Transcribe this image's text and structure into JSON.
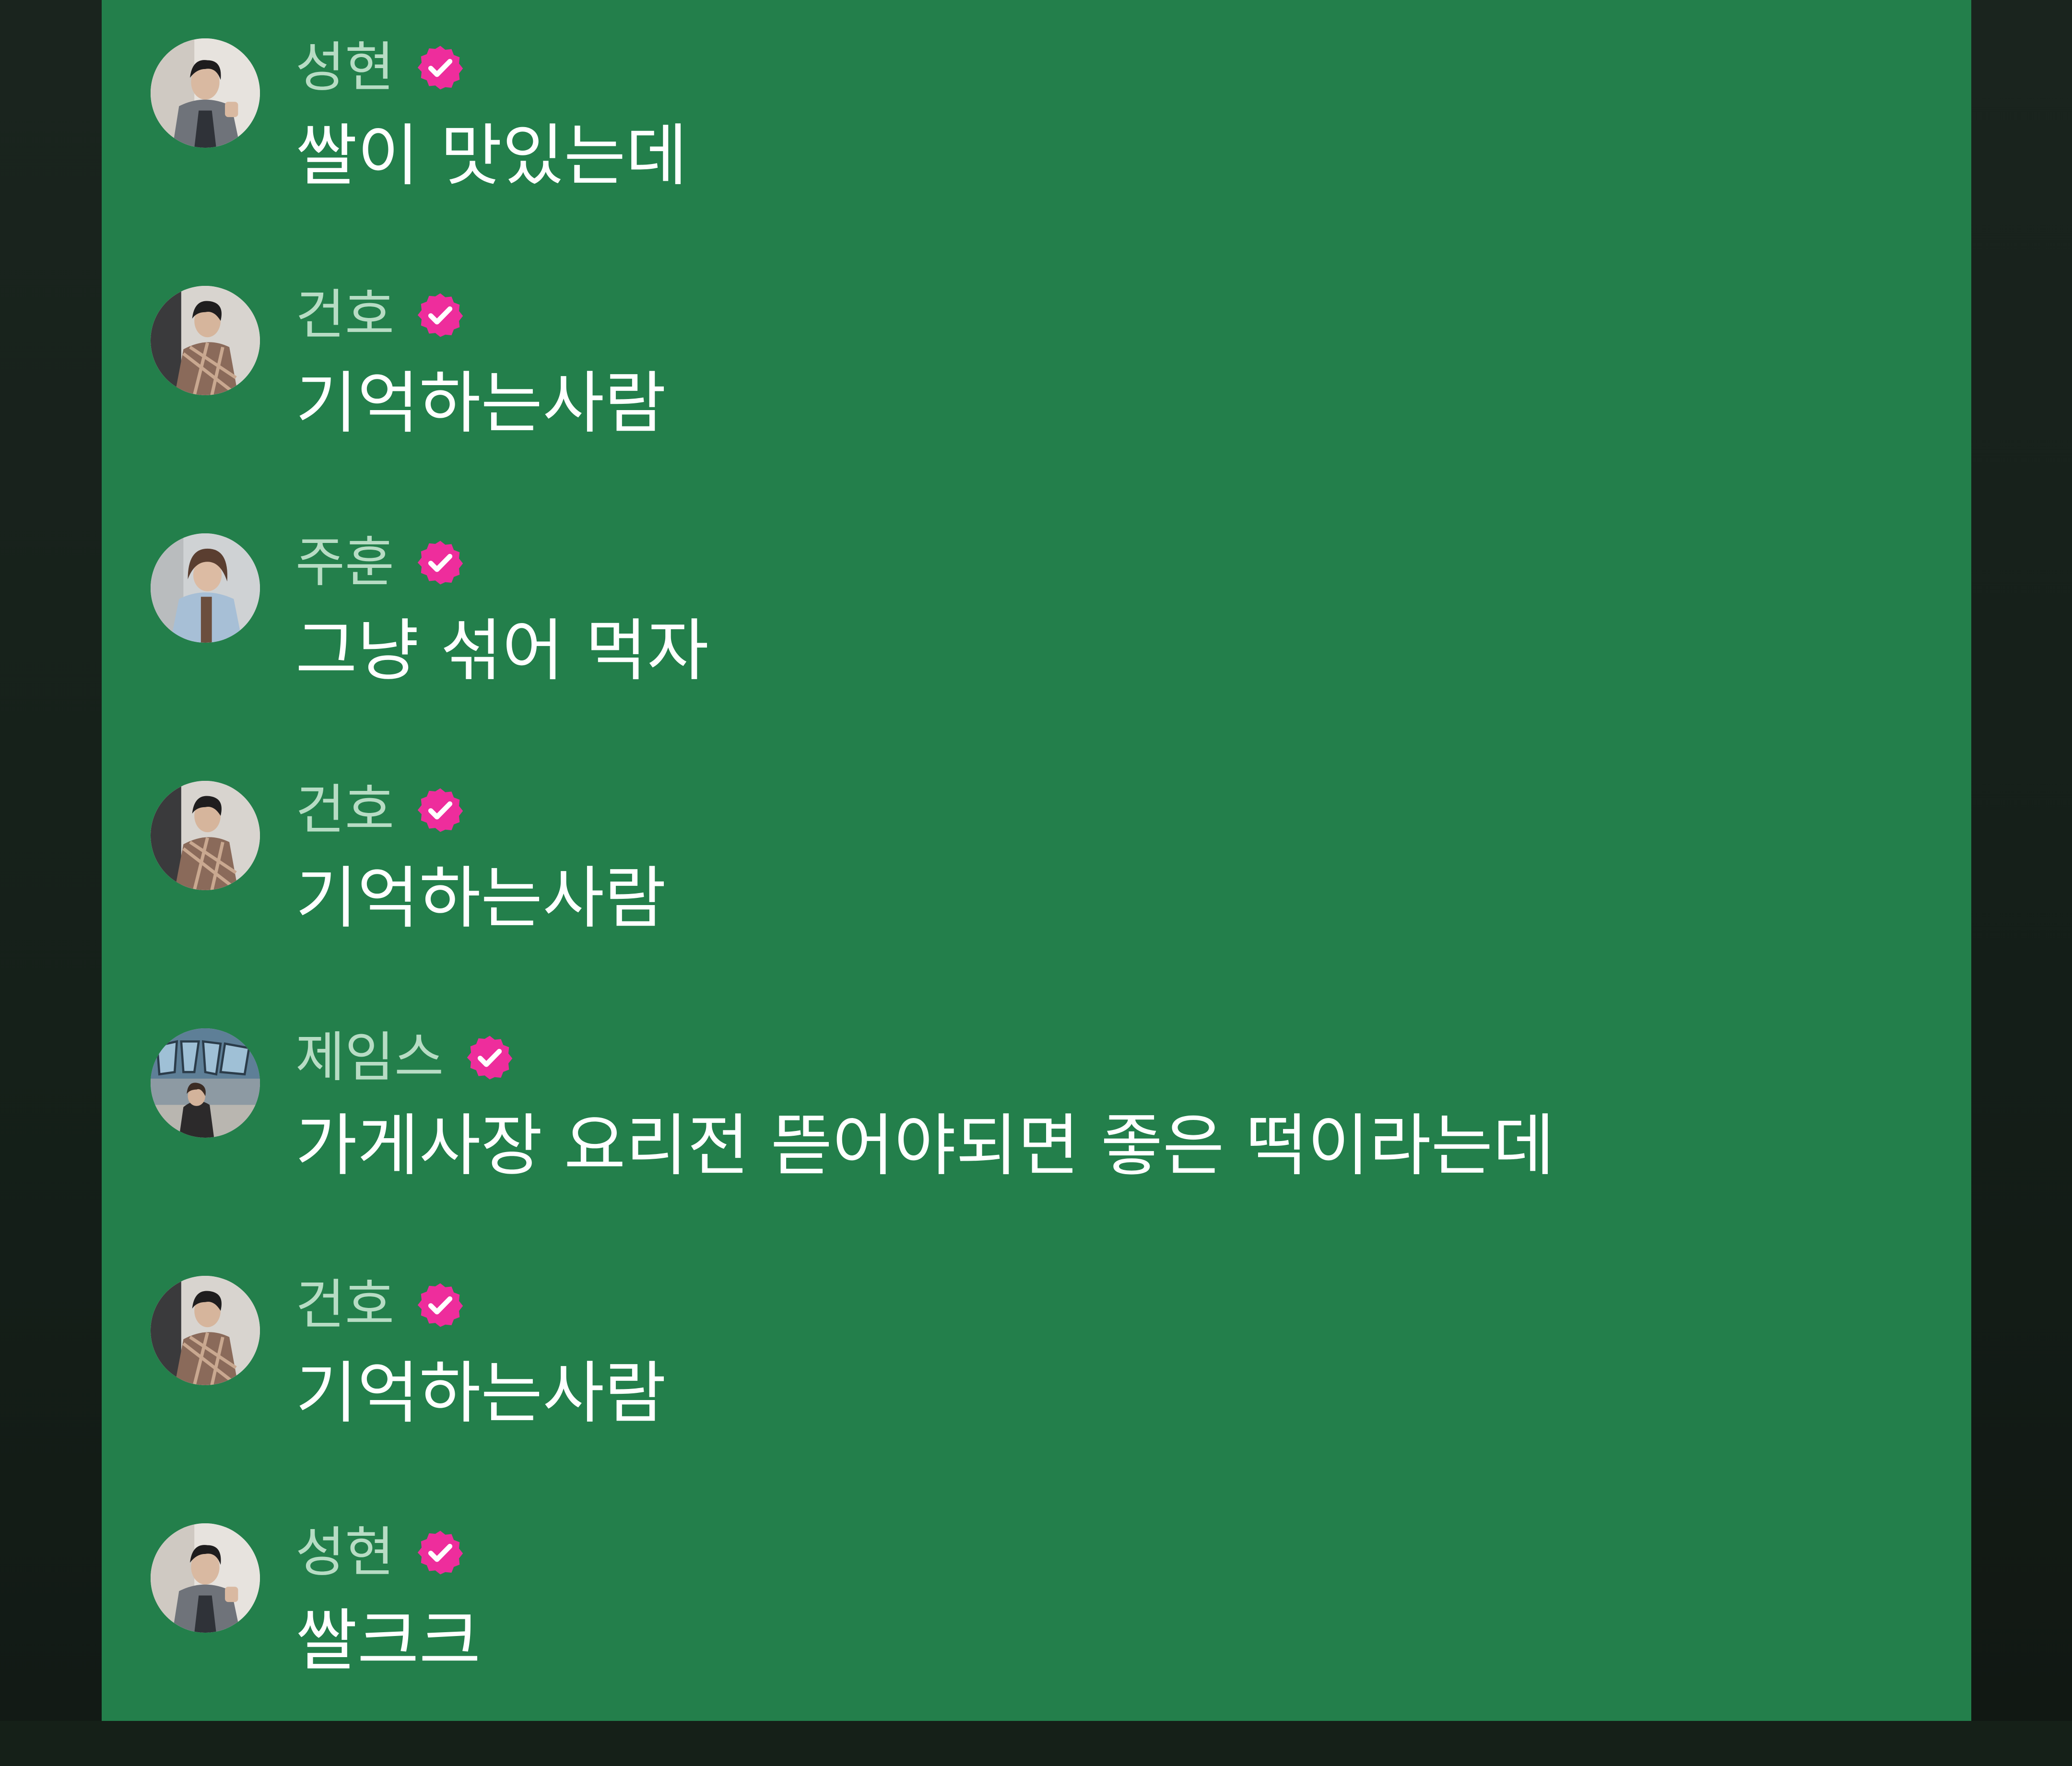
{
  "colors": {
    "panel_background": "#237f4b",
    "side_background": "#152018",
    "username_text": "#b7dcc4",
    "message_text": "#ffffff",
    "verified_badge": "#ee2d9c"
  },
  "chat": {
    "messages": [
      {
        "user": "성현",
        "text": "쌀이 맛있는데",
        "verified": true,
        "avatar": "avatar-seonghyeon"
      },
      {
        "user": "건호",
        "text": "기억하는사람",
        "verified": true,
        "avatar": "avatar-geonho"
      },
      {
        "user": "주훈",
        "text": "그냥 섞어 먹자",
        "verified": true,
        "avatar": "avatar-juhun"
      },
      {
        "user": "건호",
        "text": "기억하는사람",
        "verified": true,
        "avatar": "avatar-geonho"
      },
      {
        "user": "제임스",
        "text": "가게사장 요리전 뜯어야되면 좋은 떡이라는데",
        "verified": true,
        "avatar": "avatar-james"
      },
      {
        "user": "건호",
        "text": "기억하는사람",
        "verified": true,
        "avatar": "avatar-geonho"
      },
      {
        "user": "성현",
        "text": "쌀크크",
        "verified": true,
        "avatar": "avatar-seonghyeon"
      }
    ]
  }
}
